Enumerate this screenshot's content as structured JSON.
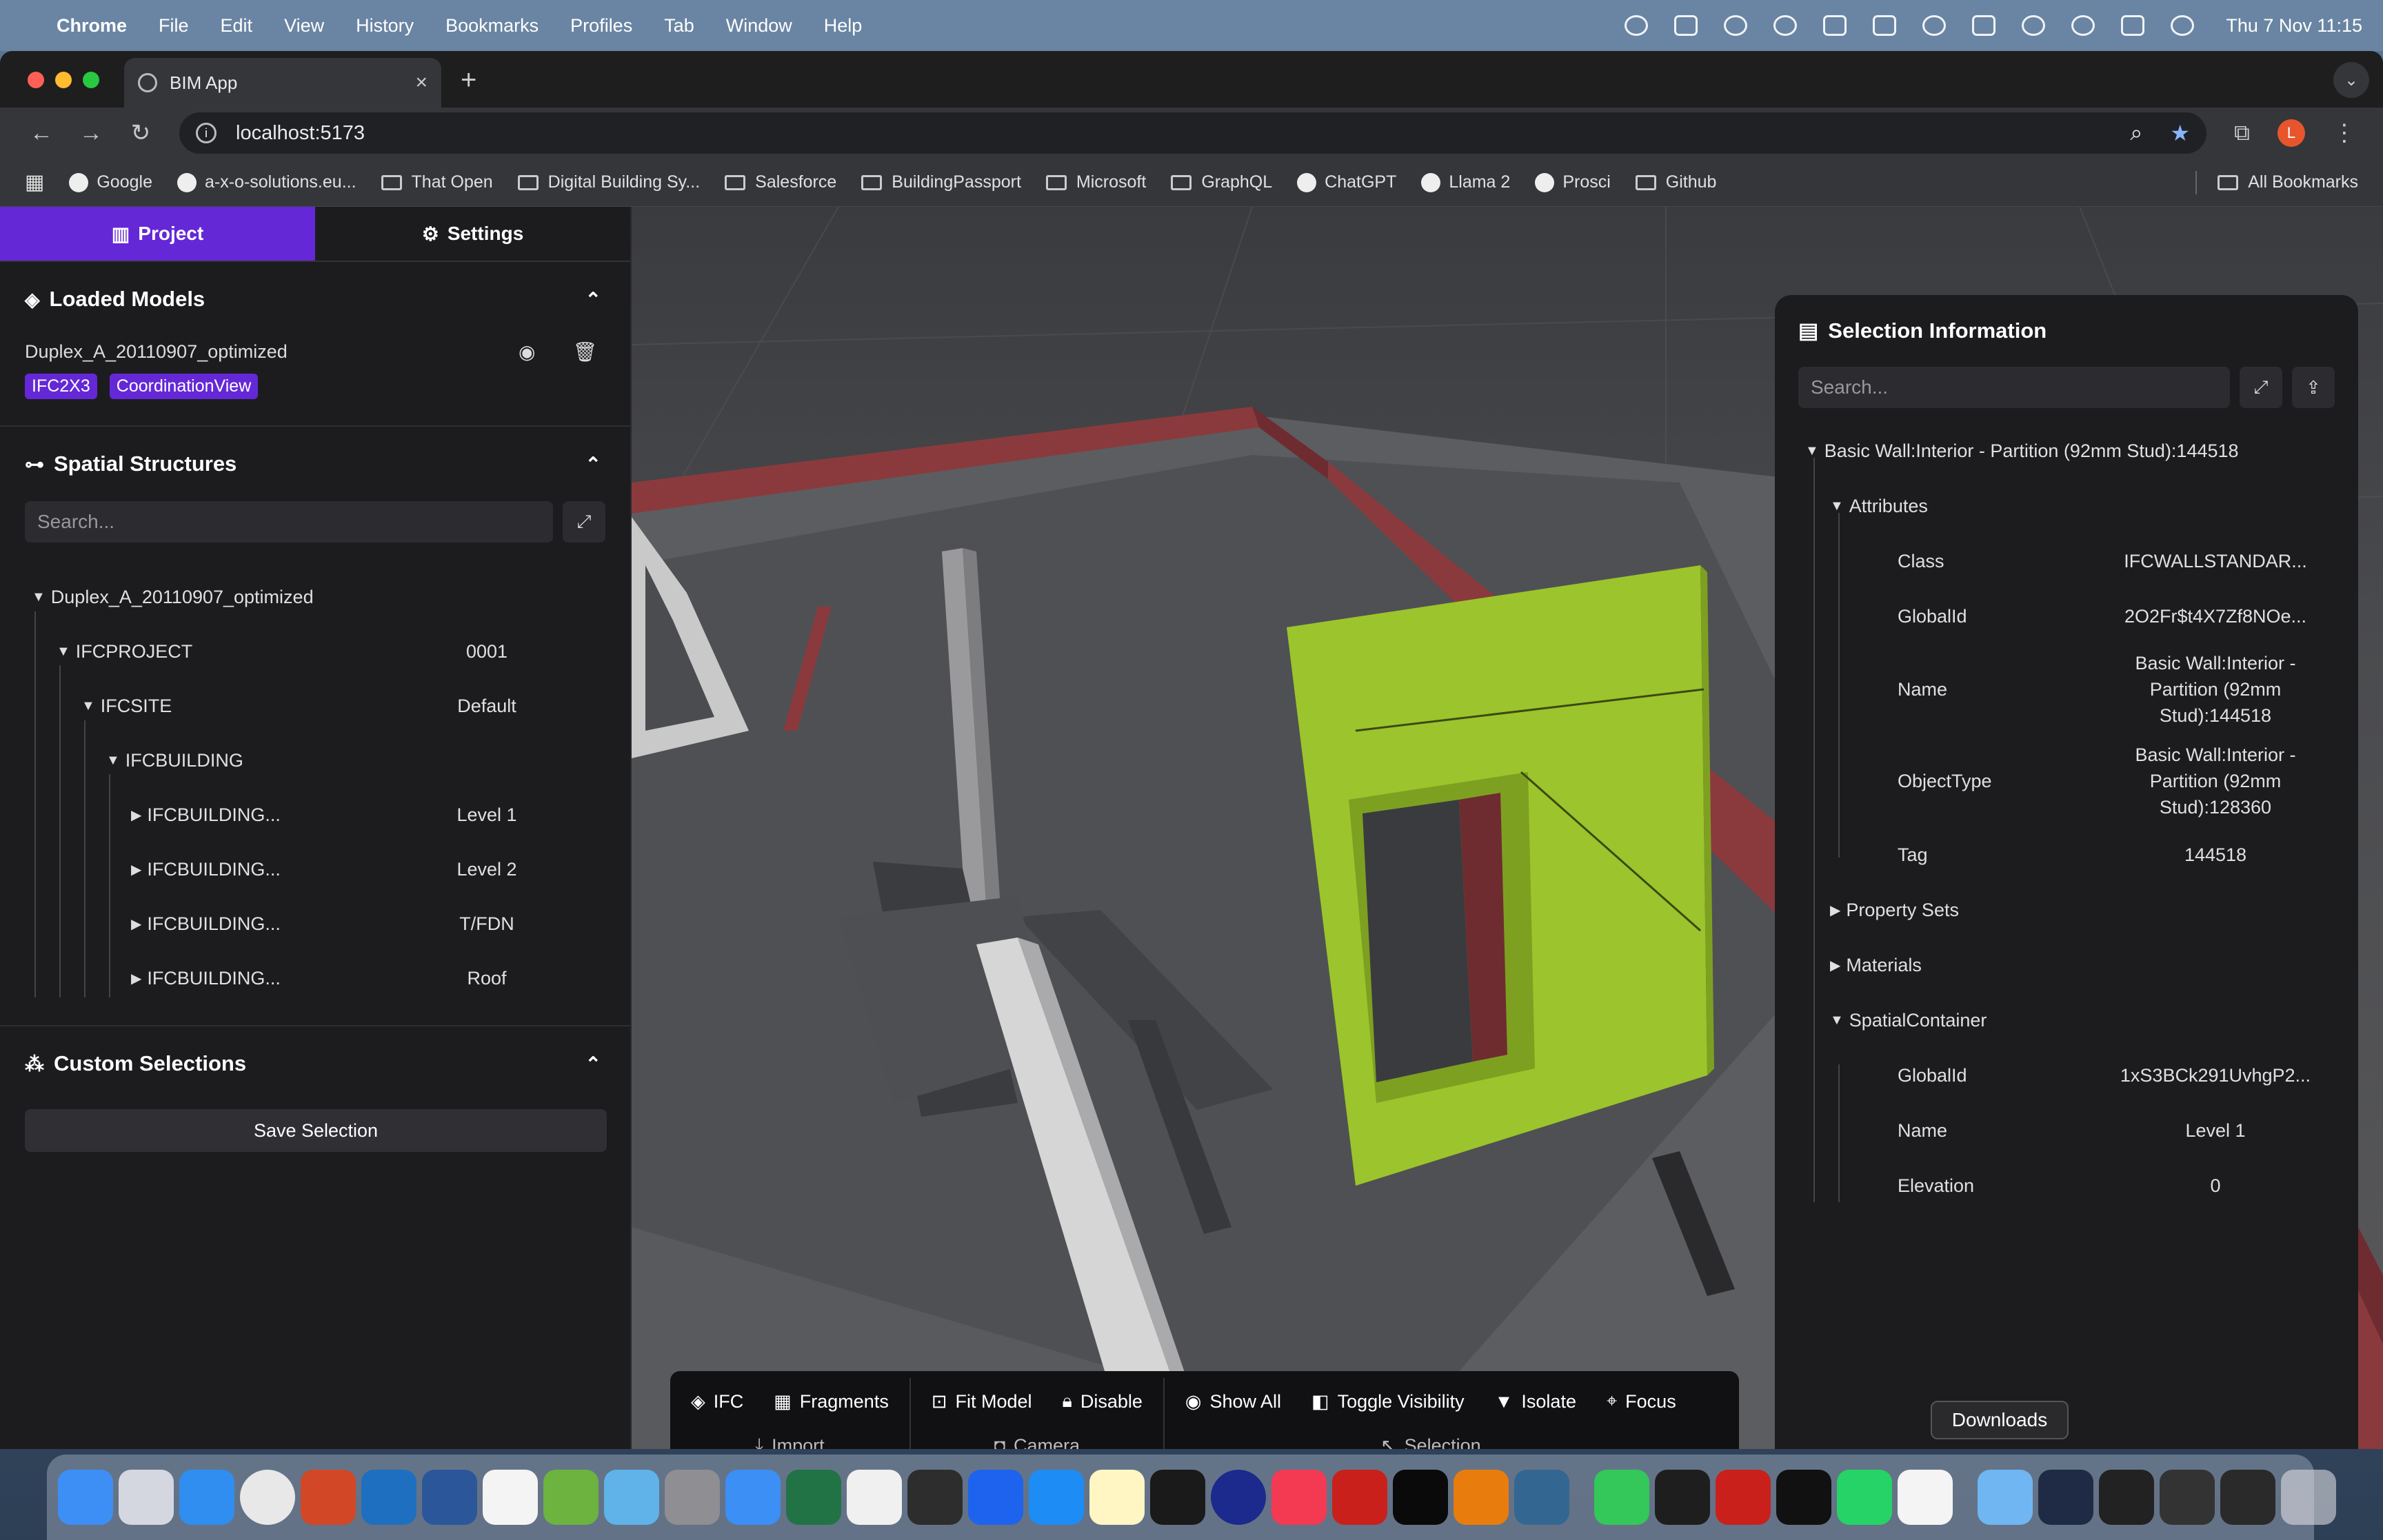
{
  "menubar": {
    "app": "Chrome",
    "items": [
      "File",
      "Edit",
      "View",
      "History",
      "Bookmarks",
      "Profiles",
      "Tab",
      "Window",
      "Help"
    ],
    "clock": "Thu 7 Nov  11:15"
  },
  "browser": {
    "tab_title": "BIM App",
    "url": "localhost:5173",
    "profile_initial": "L",
    "bookmarks": [
      {
        "label": "Google",
        "kind": "dot"
      },
      {
        "label": "a-x-o-solutions.eu...",
        "kind": "dot"
      },
      {
        "label": "That Open",
        "kind": "folder"
      },
      {
        "label": "Digital Building Sy...",
        "kind": "folder"
      },
      {
        "label": "Salesforce",
        "kind": "folder"
      },
      {
        "label": "BuildingPassport",
        "kind": "folder"
      },
      {
        "label": "Microsoft",
        "kind": "folder"
      },
      {
        "label": "GraphQL",
        "kind": "folder"
      },
      {
        "label": "ChatGPT",
        "kind": "dot"
      },
      {
        "label": "Llama 2",
        "kind": "dot"
      },
      {
        "label": "Prosci",
        "kind": "dot"
      },
      {
        "label": "Github",
        "kind": "folder"
      }
    ],
    "all_bookmarks": "All Bookmarks"
  },
  "left_panel": {
    "tabs": {
      "project": "Project",
      "settings": "Settings"
    },
    "loaded_models": {
      "title": "Loaded Models",
      "model_name": "Duplex_A_20110907_optimized",
      "badges": [
        "IFC2X3",
        "CoordinationView"
      ]
    },
    "spatial": {
      "title": "Spatial Structures",
      "search_placeholder": "Search...",
      "tree": [
        {
          "label": "Duplex_A_20110907_optimized",
          "value": "",
          "depth": 0,
          "open": true
        },
        {
          "label": "IFCPROJECT",
          "value": "0001",
          "depth": 1,
          "open": true
        },
        {
          "label": "IFCSITE",
          "value": "Default",
          "depth": 2,
          "open": true
        },
        {
          "label": "IFCBUILDING",
          "value": "",
          "depth": 3,
          "open": true
        },
        {
          "label": "IFCBUILDING...",
          "value": "Level 1",
          "depth": 4,
          "open": false
        },
        {
          "label": "IFCBUILDING...",
          "value": "Level 2",
          "depth": 4,
          "open": false
        },
        {
          "label": "IFCBUILDING...",
          "value": "T/FDN",
          "depth": 4,
          "open": false
        },
        {
          "label": "IFCBUILDING...",
          "value": "Roof",
          "depth": 4,
          "open": false
        }
      ]
    },
    "custom": {
      "title": "Custom Selections",
      "save_label": "Save Selection"
    }
  },
  "selection": {
    "title": "Selection Information",
    "search_placeholder": "Search...",
    "root": "Basic Wall:Interior - Partition (92mm Stud):144518",
    "attributes_label": "Attributes",
    "attributes": [
      {
        "key": "Class",
        "value": "IFCWALLSTANDAR..."
      },
      {
        "key": "GlobalId",
        "value": "2O2Fr$t4X7Zf8NOe..."
      },
      {
        "key": "Name",
        "value": "Basic Wall:Interior - Partition (92mm Stud):144518"
      },
      {
        "key": "ObjectType",
        "value": "Basic Wall:Interior - Partition (92mm Stud):128360"
      },
      {
        "key": "Tag",
        "value": "144518"
      }
    ],
    "property_sets": "Property Sets",
    "materials": "Materials",
    "spatial_container": "SpatialContainer",
    "container": [
      {
        "key": "GlobalId",
        "value": "1xS3BCk291UvhgP2..."
      },
      {
        "key": "Name",
        "value": "Level 1"
      },
      {
        "key": "Elevation",
        "value": "0"
      }
    ]
  },
  "toolbar": {
    "import": {
      "label": "Import",
      "buttons": [
        "IFC",
        "Fragments"
      ]
    },
    "camera": {
      "label": "Camera",
      "buttons": [
        "Fit Model",
        "Disable"
      ]
    },
    "selection": {
      "label": "Selection",
      "buttons": [
        "Show All",
        "Toggle Visibility",
        "Isolate",
        "Focus"
      ]
    }
  },
  "dock": {
    "tooltip": "Downloads"
  },
  "colors": {
    "accent": "#6528d7",
    "selected_wall": "#9cc42c",
    "exterior_wall": "#8a3a3d",
    "panel_bg": "#1c1c1f"
  }
}
